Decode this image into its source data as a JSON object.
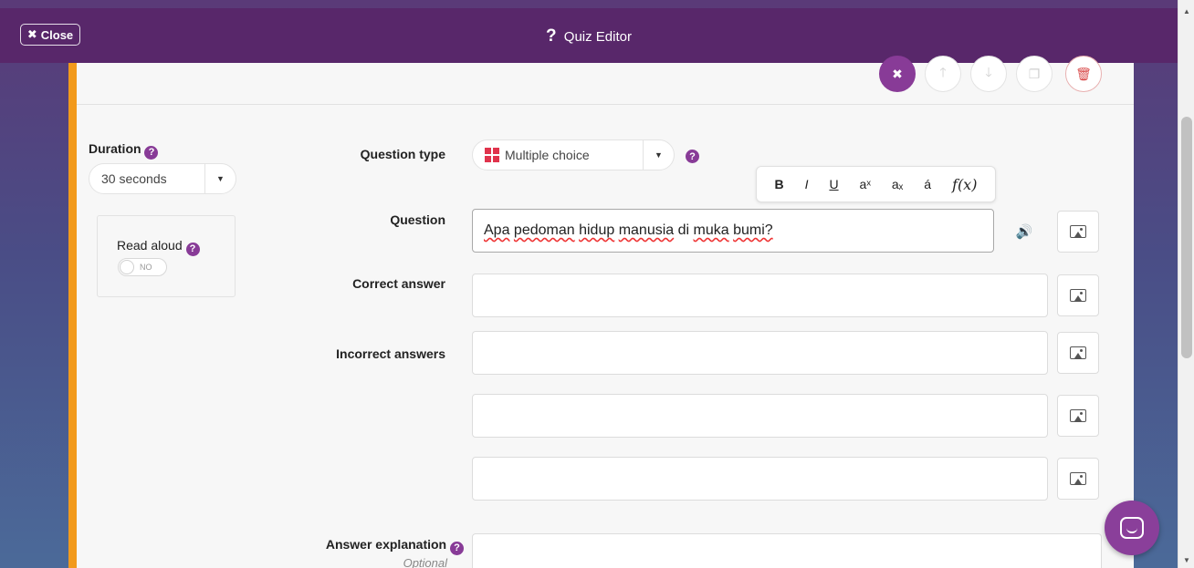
{
  "topbar": {
    "close_label": "Close",
    "title": "Quiz Editor"
  },
  "settings": {
    "duration_label": "Duration",
    "duration_value": "30 seconds",
    "read_aloud_label": "Read aloud",
    "read_aloud_toggle": "NO"
  },
  "form": {
    "question_type_label": "Question type",
    "question_type_value": "Multiple choice",
    "question_label": "Question",
    "question_words": [
      "Apa",
      "pedoman",
      "hidup",
      "manusia",
      "di",
      "muka",
      "bumi?"
    ],
    "correct_label": "Correct answer",
    "incorrect_label": "Incorrect answers",
    "explanation_label": "Answer explanation",
    "explanation_sub": "Optional"
  },
  "format_toolbar": {
    "bold": "B",
    "italic": "I",
    "underline": "U",
    "superscript": "aˣ",
    "subscript": "aₓ",
    "accent": "á",
    "formula": "f(x)"
  },
  "icons": {
    "help": "question-circle-icon",
    "image": "image-icon",
    "audio": "speaker-icon",
    "chat": "chat-icon"
  },
  "colors": {
    "header_bg": "#58276a",
    "accent": "#883b97",
    "card_border": "#f29a1c",
    "multiple_choice": "#e0334c"
  }
}
